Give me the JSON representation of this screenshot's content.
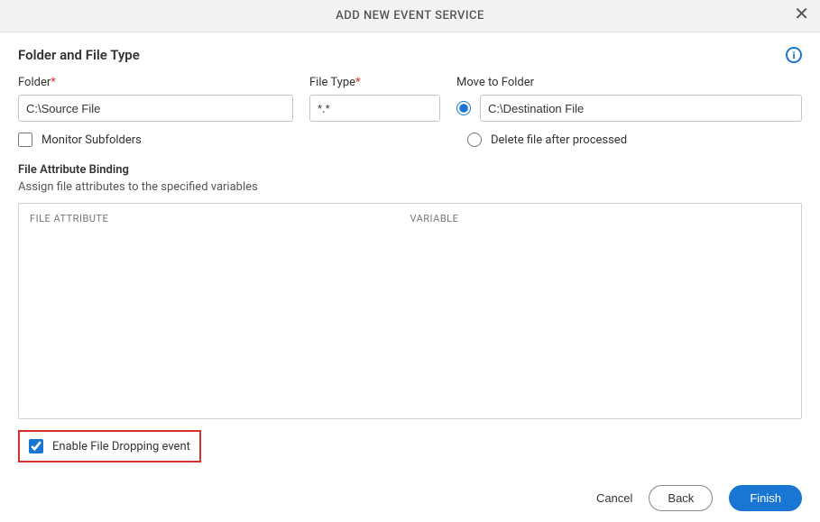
{
  "header": {
    "title": "ADD NEW EVENT SERVICE"
  },
  "section": {
    "title": "Folder and File Type"
  },
  "form": {
    "folder_label": "Folder",
    "folder_value": "C:\\Source File",
    "filetype_label": "File Type",
    "filetype_value": "*.*",
    "movefolder_label": "Move to Folder",
    "movefolder_value": "C:\\Destination File",
    "monitor_subfolders_label": "Monitor Subfolders",
    "delete_after_label": "Delete file after processed"
  },
  "binding": {
    "title": "File Attribute Binding",
    "desc": "Assign file attributes to the specified variables",
    "col_attr": "FILE ATTRIBUTE",
    "col_var": "VARIABLE"
  },
  "enable": {
    "label": "Enable File Dropping event"
  },
  "footer": {
    "cancel": "Cancel",
    "back": "Back",
    "finish": "Finish"
  }
}
